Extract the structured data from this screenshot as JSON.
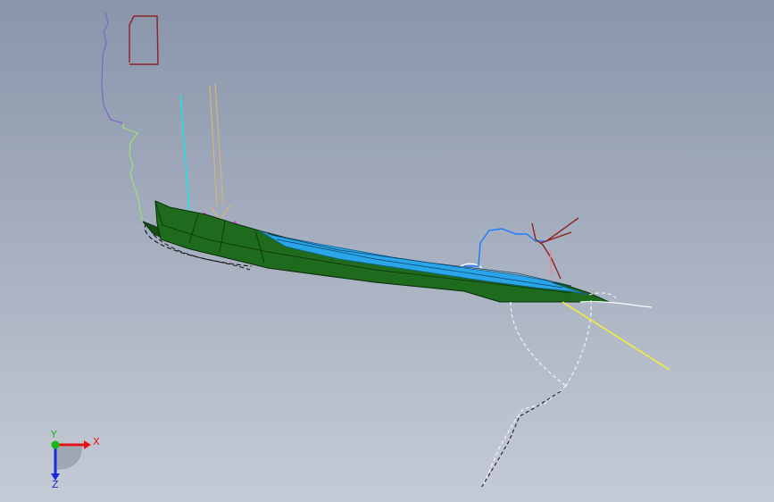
{
  "view": {
    "background_top": "#8995aa",
    "background_bottom": "#c5cbd6"
  },
  "model": {
    "hull_color": "#1e6b1e",
    "hull_edge_color": "#0b300b",
    "deck_color": "#2aa6e8"
  },
  "triad": {
    "x_label": "X",
    "y_label": "Y",
    "z_label": "Z",
    "x_color": "#e01414",
    "y_color": "#18b818",
    "z_color": "#1a2ad8"
  }
}
